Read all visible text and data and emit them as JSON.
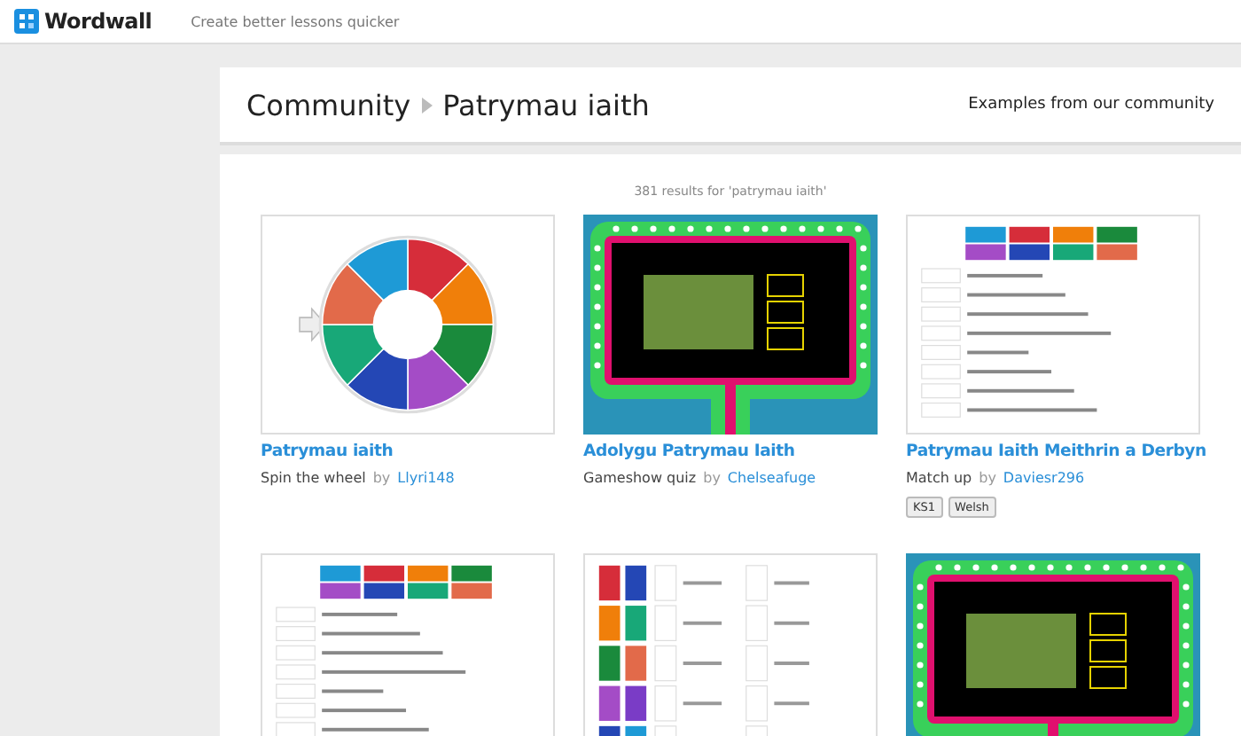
{
  "header": {
    "brand": "Wordwall",
    "tagline": "Create better lessons quicker"
  },
  "breadcrumb": {
    "parent": "Community",
    "current": "Patrymau iaith"
  },
  "header_link": "Examples from our community",
  "results_summary": "381 results for 'patrymau iaith'",
  "cards": [
    {
      "kind": "wheel",
      "title": "Patrymau iaith",
      "template": "Spin the wheel",
      "by": "by",
      "author": "Llyri148"
    },
    {
      "kind": "gameshow",
      "title": "Adolygu Patrymau Iaith",
      "template": "Gameshow quiz",
      "by": "by",
      "author": "Chelseafuge"
    },
    {
      "kind": "matchup",
      "title": "Patrymau Iaith Meithrin a Derbyn",
      "template": "Match up",
      "by": "by",
      "author": "Daviesr296",
      "tags": [
        "KS1",
        "Welsh"
      ]
    },
    {
      "kind": "matchup"
    },
    {
      "kind": "picturematch"
    },
    {
      "kind": "gameshow"
    }
  ]
}
